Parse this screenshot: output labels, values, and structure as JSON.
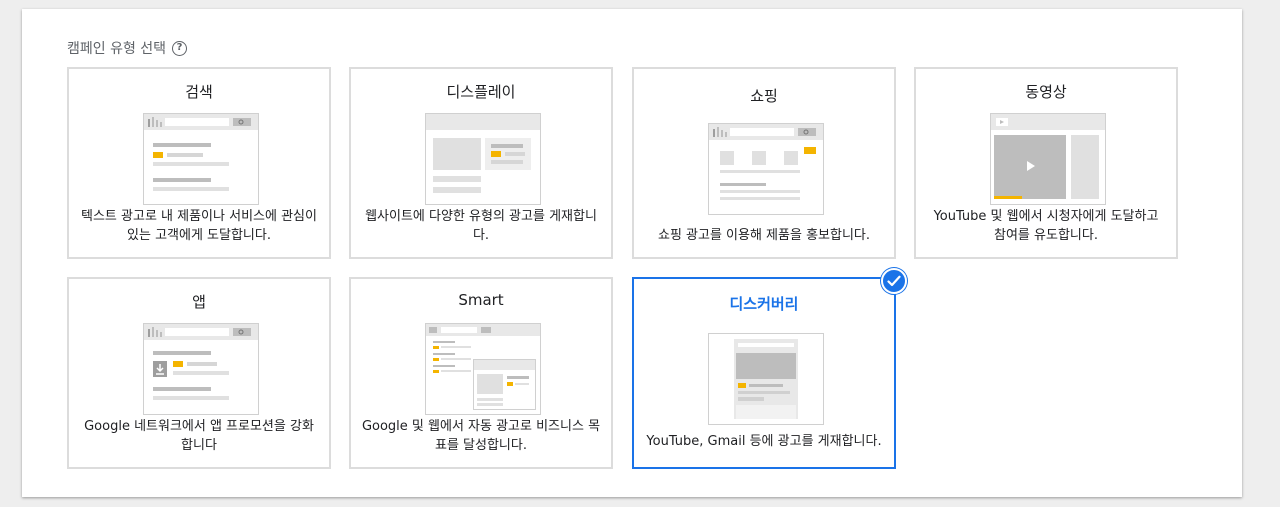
{
  "heading": {
    "text": "캠페인 유형 선택",
    "help_icon": "?"
  },
  "cards": [
    {
      "title": "검색",
      "desc": "텍스트 광고로 내 제품이나 서비스에 관심이 있는 고객에게 도달합니다.",
      "icon": "search-ad-illustration"
    },
    {
      "title": "디스플레이",
      "desc": "웹사이트에 다양한 유형의 광고를 게재합니다.",
      "icon": "display-ad-illustration"
    },
    {
      "title": "쇼핑",
      "desc": "쇼핑 광고를 이용해 제품을 홍보합니다.",
      "icon": "shopping-ad-illustration"
    },
    {
      "title": "동영상",
      "desc": "YouTube 및 웹에서 시청자에게 도달하고 참여를 유도합니다.",
      "icon": "video-ad-illustration"
    },
    {
      "title": "앱",
      "desc": "Google 네트워크에서 앱 프로모션을 강화합니다",
      "icon": "app-ad-illustration"
    },
    {
      "title": "Smart",
      "desc": "Google 및 웹에서 자동 광고로 비즈니스 목표를 달성합니다.",
      "icon": "smart-ad-illustration"
    },
    {
      "title": "디스커버리",
      "desc": "YouTube, Gmail 등에 광고를 게재합니다.",
      "icon": "discovery-ad-illustration",
      "selected": true
    }
  ],
  "colors": {
    "accent": "#1a73e8",
    "yellow": "#f4b400",
    "gray": "#bdbdbd",
    "light": "#e8e8e8"
  }
}
